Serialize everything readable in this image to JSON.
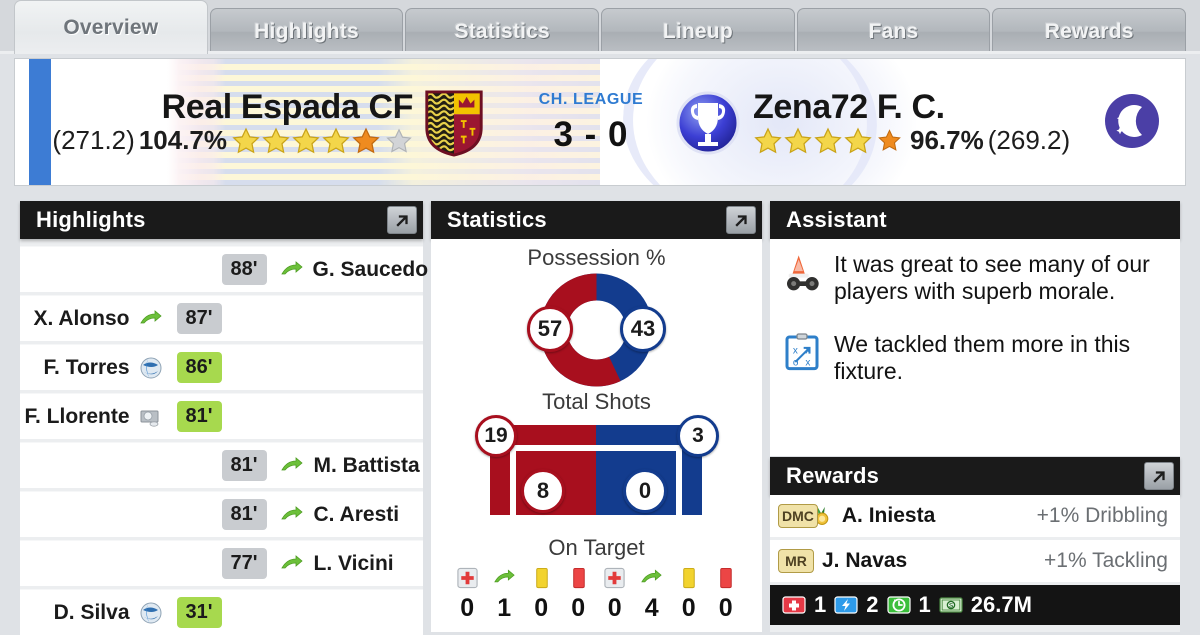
{
  "tabs": [
    {
      "label": "Overview",
      "active": true
    },
    {
      "label": "Highlights",
      "active": false
    },
    {
      "label": "Statistics",
      "active": false
    },
    {
      "label": "Lineup",
      "active": false
    },
    {
      "label": "Fans",
      "active": false
    },
    {
      "label": "Rewards",
      "active": false
    }
  ],
  "match": {
    "competition": "CH. LEAGUE",
    "score": "3 - 0",
    "home": {
      "name": "Real Espada CF",
      "strength": "(271.2)",
      "percent": "104.7%",
      "stars_full": 5,
      "stars_empty": 1,
      "crest_icon": "shield-crest-icon"
    },
    "away": {
      "name": "Zena72 F. C.",
      "strength": "(269.2)",
      "percent": "96.7%",
      "stars_full": 4,
      "stars_half": 1,
      "crest_icon": "trophy-badge-icon"
    },
    "night_icon": "moon-night-icon"
  },
  "highlights": {
    "title": "Highlights",
    "expand_icon": "expand-arrow-icon",
    "events": [
      {
        "side": "away",
        "minute": "88'",
        "player": "G. Saucedo",
        "icon": "substitution-icon",
        "minute_color": "grey"
      },
      {
        "side": "home",
        "minute": "87'",
        "player": "X. Alonso",
        "icon": "substitution-icon",
        "minute_color": "grey"
      },
      {
        "side": "home",
        "minute": "86'",
        "player": "F. Torres",
        "icon": "goal-ball-icon",
        "minute_color": "green"
      },
      {
        "side": "home",
        "minute": "81'",
        "player": "F. Llorente",
        "icon": "assist-goal-icon",
        "minute_color": "green"
      },
      {
        "side": "away",
        "minute": "81'",
        "player": "M. Battista",
        "icon": "substitution-icon",
        "minute_color": "grey"
      },
      {
        "side": "away",
        "minute": "81'",
        "player": "C. Aresti",
        "icon": "substitution-icon",
        "minute_color": "grey"
      },
      {
        "side": "away",
        "minute": "77'",
        "player": "L. Vicini",
        "icon": "substitution-icon",
        "minute_color": "grey"
      },
      {
        "side": "home",
        "minute": "31'",
        "player": "D. Silva",
        "icon": "goal-ball-icon",
        "minute_color": "green"
      }
    ]
  },
  "statistics": {
    "title": "Statistics",
    "expand_icon": "expand-arrow-icon",
    "icon_row": [
      {
        "name": "injury-icon",
        "home": "0",
        "away": "0"
      },
      {
        "name": "substitution-icon",
        "home": "1",
        "away": "4"
      },
      {
        "name": "yellow-card-icon",
        "home": "0",
        "away": "0"
      },
      {
        "name": "red-card-icon",
        "home": "0",
        "away": "0"
      }
    ]
  },
  "chart_data": [
    {
      "type": "pie",
      "title": "Possession %",
      "categories": [
        "Real Espada CF",
        "Zena72 F. C."
      ],
      "values": [
        57,
        43
      ],
      "colors": [
        "#a80f1e",
        "#133c8e"
      ],
      "labels": [
        "57",
        "43"
      ],
      "donut": true,
      "legend": "none"
    },
    {
      "type": "bar",
      "title": "Total Shots",
      "categories": [
        "Real Espada CF",
        "Zena72 F. C."
      ],
      "values": [
        19,
        3
      ],
      "colors": [
        "#a80f1e",
        "#133c8e"
      ],
      "labels": [
        "19",
        "3"
      ],
      "orientation": "horizontal-opposed"
    },
    {
      "type": "bar",
      "title": "On Target",
      "categories": [
        "Real Espada CF",
        "Zena72 F. C."
      ],
      "values": [
        8,
        0
      ],
      "colors": [
        "#a80f1e",
        "#133c8e"
      ],
      "labels": [
        "8",
        "0"
      ],
      "orientation": "horizontal-opposed"
    }
  ],
  "assistant": {
    "title": "Assistant",
    "notes": [
      {
        "icon": "training-cone-icon",
        "text": "It was great to see many of our players with superb morale."
      },
      {
        "icon": "tactics-board-icon",
        "text": "We tackled them more in this fixture."
      }
    ]
  },
  "rewards": {
    "title": "Rewards",
    "expand_icon": "expand-arrow-icon",
    "items": [
      {
        "position": "DMC",
        "medal": true,
        "player": "A. Iniesta",
        "bonus": "+1% Dribbling"
      },
      {
        "position": "MR",
        "medal": false,
        "player": "J. Navas",
        "bonus": "+1% Tackling"
      }
    ],
    "resources": [
      {
        "icon": "health-pack-icon",
        "value": "1"
      },
      {
        "icon": "energy-bolt-icon",
        "value": "2"
      },
      {
        "icon": "rest-clock-icon",
        "value": "1"
      },
      {
        "icon": "money-icon",
        "value": "26.7M"
      }
    ]
  }
}
